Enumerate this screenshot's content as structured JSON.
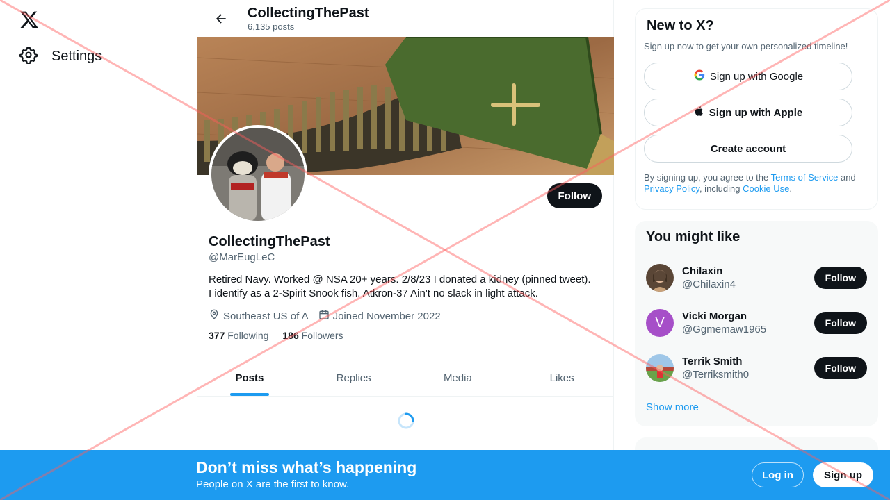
{
  "nav": {
    "settings_label": "Settings",
    "logo_icon": "x-logo-icon",
    "settings_icon": "gear-icon"
  },
  "header": {
    "name": "CollectingThePast",
    "posts_count": "6,135 posts"
  },
  "profile": {
    "follow_label": "Follow",
    "name": "CollectingThePast",
    "handle": "@MarEugLeC",
    "bio_line1": "Retired Navy. Worked @ NSA 20+ years. 2/8/23 I donated a kidney (pinned tweet).",
    "bio_line2": "I identify as a 2-Spirit Snook fish. Atkron-37 Ain't no slack in light attack.",
    "location": "Southeast US of A",
    "joined": "Joined November 2022",
    "following_count": "377",
    "following_label": "Following",
    "followers_count": "186",
    "followers_label": "Followers"
  },
  "tabs": [
    {
      "label": "Posts"
    },
    {
      "label": "Replies"
    },
    {
      "label": "Media"
    },
    {
      "label": "Likes"
    }
  ],
  "signup_card": {
    "title": "New to X?",
    "subtitle": "Sign up now to get your own personalized timeline!",
    "google_label": "Sign up with Google",
    "apple_label": "Sign up with Apple",
    "create_label": "Create account",
    "legal_prefix": "By signing up, you agree to the ",
    "terms": "Terms of Service",
    "and": " and",
    "privacy": "Privacy Policy",
    "including": ", including ",
    "cookie": "Cookie Use",
    "period": "."
  },
  "suggestions": {
    "title": "You might like",
    "items": [
      {
        "name": "Chilaxin",
        "handle": "@Chilaxin4",
        "follow": "Follow"
      },
      {
        "name": "Vicki Morgan",
        "handle": "@Ggmemaw1965",
        "follow": "Follow",
        "initial": "V"
      },
      {
        "name": "Terrik Smith",
        "handle": "@Terriksmith0",
        "follow": "Follow"
      }
    ],
    "show_more": "Show more"
  },
  "bottom": {
    "headline": "Don’t miss what’s happening",
    "subline": "People on X are the first to know.",
    "login": "Log in",
    "signup": "Sign up"
  },
  "colors": {
    "accent": "#1d9bf0",
    "dark": "#0f1419",
    "muted": "#536471",
    "overlay_x": "#ff6b6b"
  }
}
